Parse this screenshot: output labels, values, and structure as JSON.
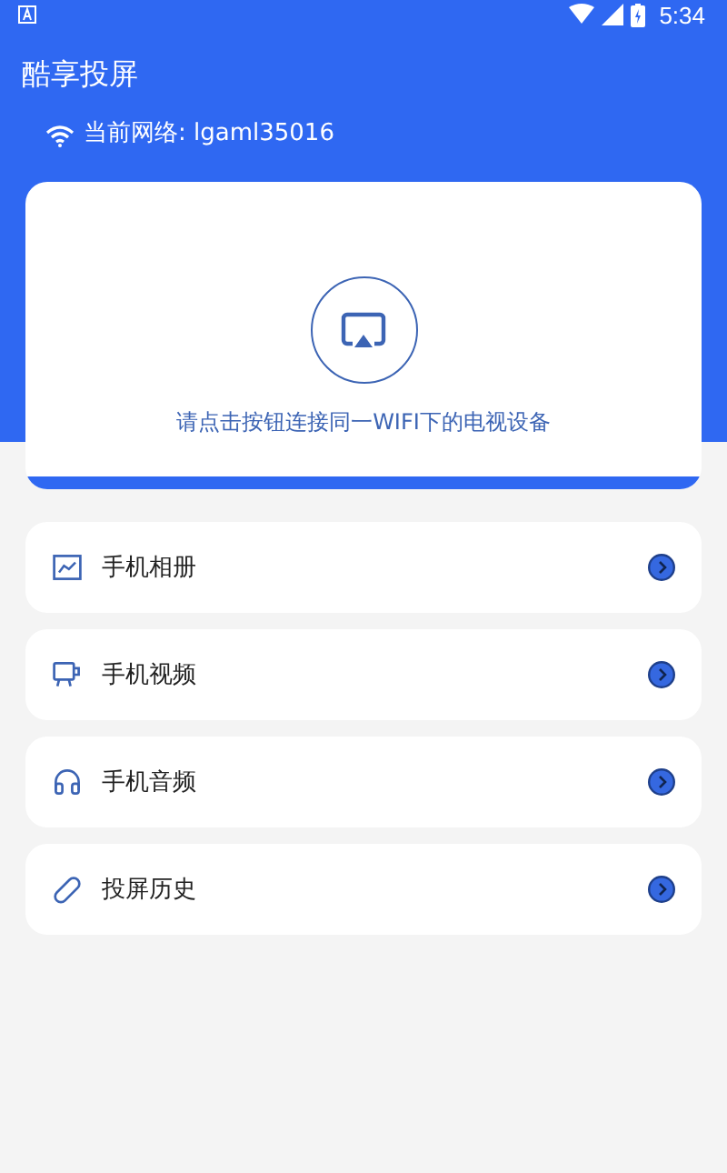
{
  "status_bar": {
    "time": "5:34"
  },
  "header": {
    "title": "酷享投屏",
    "network": "当前网络: lgaml35016"
  },
  "cast_card": {
    "hint": "请点击按钮连接同一WIFI下的电视设备"
  },
  "menu": [
    {
      "kind": "album",
      "label": "手机相册"
    },
    {
      "kind": "video",
      "label": "手机视频"
    },
    {
      "kind": "audio",
      "label": "手机音频"
    },
    {
      "kind": "history",
      "label": "投屏历史"
    }
  ]
}
